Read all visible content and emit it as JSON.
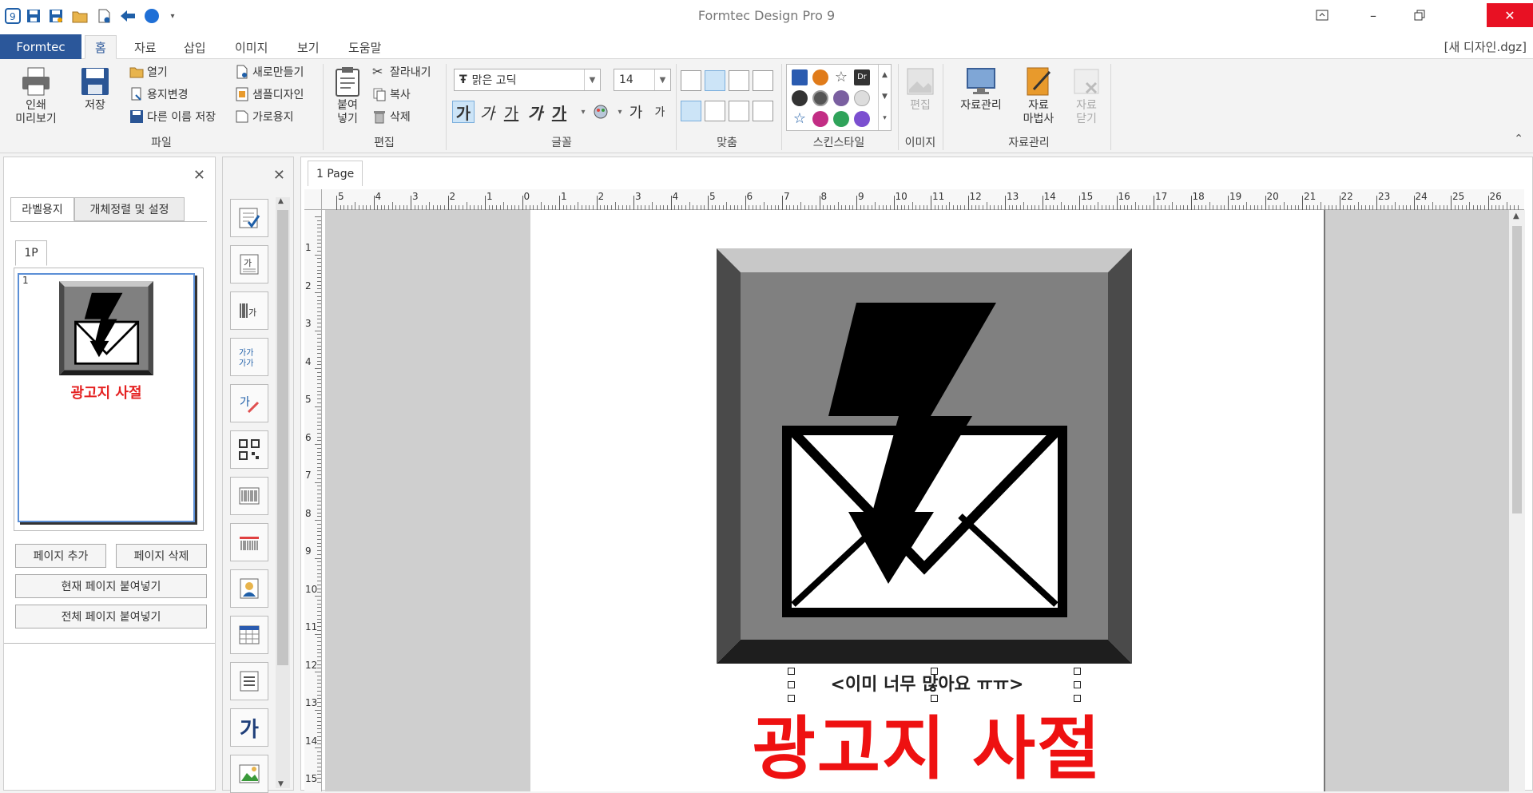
{
  "window": {
    "title": "Formtec Design Pro 9"
  },
  "ribbon_tabs": {
    "app_tab": "Formtec",
    "tabs": [
      "홈",
      "자료",
      "삽입",
      "이미지",
      "보기",
      "도움말"
    ],
    "document_name": "[새 디자인.dgz]"
  },
  "ribbon": {
    "file": {
      "print_preview": "인쇄\n미리보기",
      "save": "저장",
      "open": "열기",
      "change_paper": "용지변경",
      "save_as": "다른 이름 저장",
      "new": "새로만들기",
      "sample_design": "샘플디자인",
      "landscape": "가로용지",
      "group": "파일"
    },
    "edit": {
      "paste": "붙여\n넣기",
      "cut": "잘라내기",
      "copy": "복사",
      "delete": "삭제",
      "group": "편집"
    },
    "font": {
      "font_name": "맑은 고딕",
      "font_size": "14",
      "styles": [
        "가",
        "가",
        "가",
        "가",
        "가"
      ],
      "group": "글꼴"
    },
    "align": {
      "group": "맞춤"
    },
    "skin": {
      "group": "스킨스타일"
    },
    "image": {
      "edit": "편집",
      "group": "이미지"
    },
    "data": {
      "manage": "자료관리",
      "wizard": "자료\n마법사",
      "close": "자료\n닫기",
      "group": "자료관리"
    }
  },
  "left_panel": {
    "tabs": [
      "라벨용지",
      "개체정렬 및 설정"
    ],
    "page_tab": "1P",
    "thumb_number": "1",
    "thumb_title": "광고지 사절",
    "buttons": {
      "add_page": "페이지 추가",
      "delete_page": "페이지 삭제",
      "paste_current": "현재 페이지 붙여넣기",
      "paste_all": "전체 페이지 붙여넣기"
    }
  },
  "canvas": {
    "page_tab": "1 Page",
    "h_ruler_labels": [
      "5",
      "4",
      "3",
      "2",
      "1",
      "0",
      "1",
      "2",
      "3",
      "4",
      "5",
      "6",
      "7",
      "8",
      "9",
      "10",
      "11",
      "12",
      "13",
      "14",
      "15",
      "16",
      "17",
      "18",
      "19",
      "20",
      "21",
      "22",
      "23",
      "24",
      "25",
      "26"
    ],
    "v_ruler_labels": [
      "1",
      "2",
      "3",
      "4",
      "5",
      "6",
      "7",
      "8",
      "9",
      "10",
      "11",
      "12",
      "13",
      "14",
      "15"
    ],
    "design_small_text": "<이미 너무 많아요 ㅠㅠ>",
    "design_big_text": "광고지 사절"
  },
  "colors": {
    "accent": "#2b579a",
    "close_button": "#e81123",
    "design_red": "#ee1111"
  }
}
